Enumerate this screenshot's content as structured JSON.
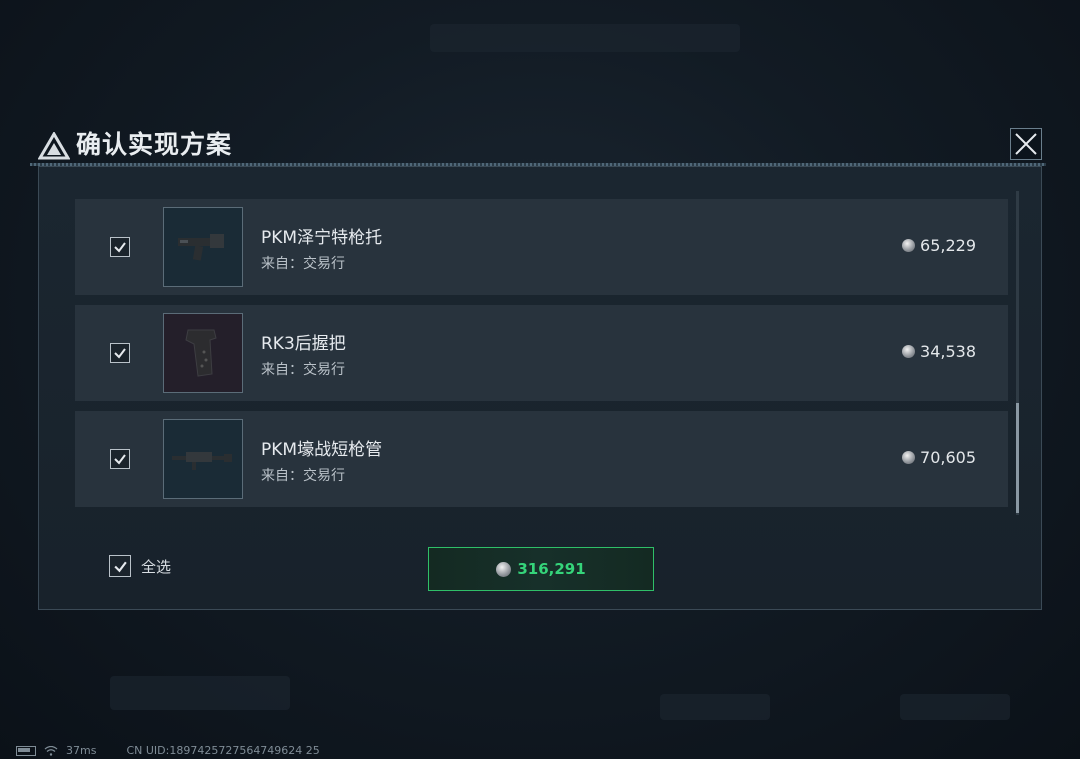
{
  "dialog": {
    "title": "确认实现方案",
    "close_label": "×"
  },
  "items": [
    {
      "name": "PKM泽宁特枪托",
      "source": "来自：交易行",
      "price": "65,229",
      "checked": true,
      "icon": "rifle-stock-icon"
    },
    {
      "name": "RK3后握把",
      "source": "来自：交易行",
      "price": "34,538",
      "checked": true,
      "icon": "pistol-grip-icon"
    },
    {
      "name": "PKM壕战短枪管",
      "source": "来自：交易行",
      "price": "70,605",
      "checked": true,
      "icon": "short-barrel-icon"
    }
  ],
  "footer": {
    "select_all_label": "全选",
    "select_all_checked": true,
    "total": "316,291"
  },
  "status": {
    "ping": "37ms",
    "uid": "CN UID:1897425727564749624 25"
  },
  "colors": {
    "accent_green": "#35d47a",
    "panel_bg": "#1b2630",
    "row_bg": "#28333d"
  }
}
